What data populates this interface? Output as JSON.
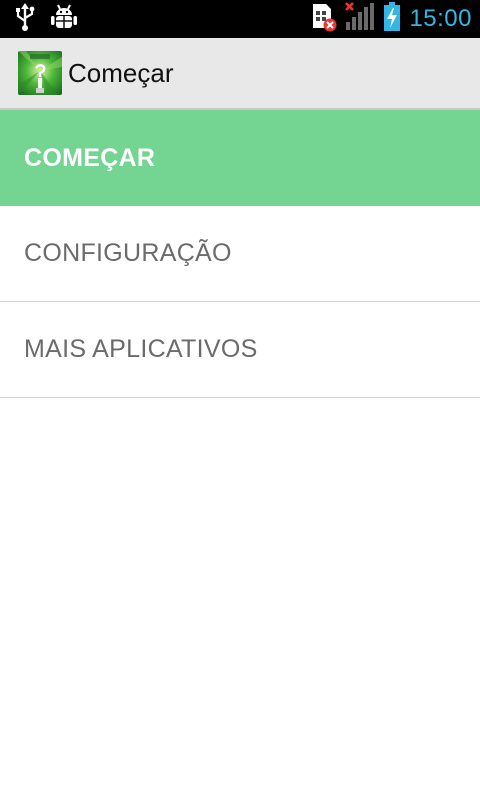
{
  "status_bar": {
    "time": "15:00",
    "left_icons": [
      "usb-icon",
      "android-debug-icon"
    ],
    "right_icons": [
      "no-sim-icon",
      "signal-none-icon",
      "battery-charging-icon"
    ],
    "clock_color": "#33b5e5"
  },
  "action_bar": {
    "title": "Começar",
    "icon": "app-icon"
  },
  "menu": {
    "items": [
      {
        "label": "COMEÇAR",
        "selected": true
      },
      {
        "label": "CONFIGURAÇÃO",
        "selected": false
      },
      {
        "label": "MAIS APLICATIVOS",
        "selected": false
      }
    ]
  },
  "colors": {
    "selected_item": "#74d491",
    "item_text": "#6b6b6b",
    "action_bar_bg": "#e8e8e8"
  }
}
